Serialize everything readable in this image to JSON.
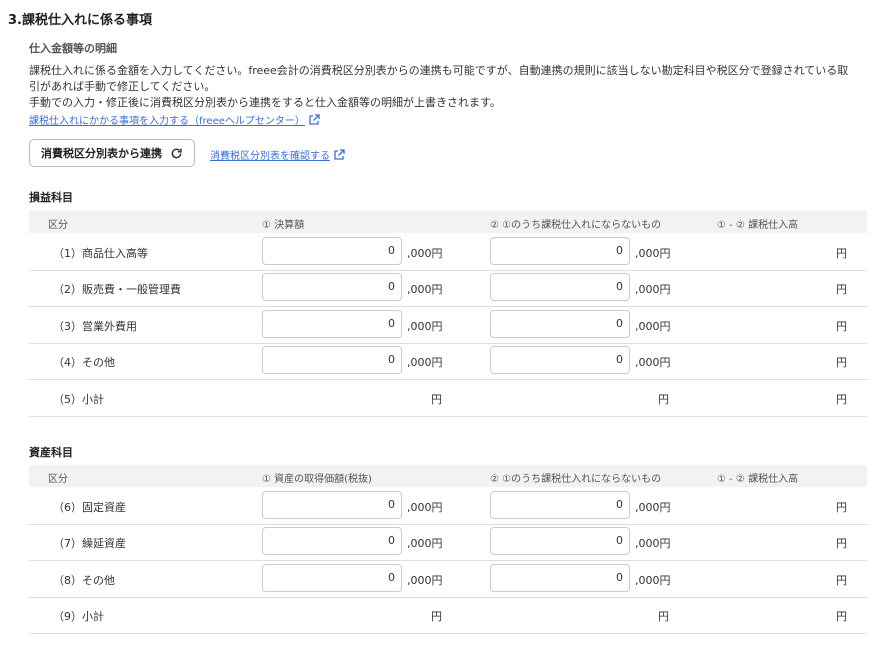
{
  "section_title": "3.課税仕入れに係る事項",
  "subsection_title": "仕入金額等の明細",
  "description_lines": [
    "課税仕入れに係る金額を入力してください。freee会計の消費税区分別表からの連携も可能ですが、自動連携の規則に該当しない勘定科目や税区分で登録されている取",
    "引があれば手動で修正してください。",
    "手動での入力・修正後に消費税区分別表から連携をすると仕入金額等の明細が上書きされます。"
  ],
  "help_link": "課税仕入れにかかる事項を入力する（freeeヘルプセンター）",
  "sync_button": "消費税区分別表から連携",
  "confirm_link": "消費税区分別表を確認する",
  "colors": {
    "link": "#3b6fd6",
    "header_bg": "#f2f2f2"
  },
  "icons": [
    "external-link-icon",
    "refresh-icon"
  ],
  "profit": {
    "title": "損益科目",
    "headers": [
      "区分",
      "① 決算額",
      "② ①のうち課税仕入れにならないもの",
      "① - ② 課税仕入高"
    ],
    "rows": [
      {
        "label": "（1）商品仕入高等",
        "v1": "0",
        "v2": "0"
      },
      {
        "label": "（2）販売費・一般管理費",
        "v1": "0",
        "v2": "0"
      },
      {
        "label": "（3）営業外費用",
        "v1": "0",
        "v2": "0"
      },
      {
        "label": "（4）その他",
        "v1": "0",
        "v2": "0"
      }
    ],
    "subtotal_label": "（5）小計"
  },
  "asset": {
    "title": "資産科目",
    "headers": [
      "区分",
      "① 資産の取得価額(税抜)",
      "② ①のうち課税仕入れにならないもの",
      "① - ② 課税仕入高"
    ],
    "rows": [
      {
        "label": "（6）固定資産",
        "v1": "0",
        "v2": "0"
      },
      {
        "label": "（7）繰延資産",
        "v1": "0",
        "v2": "0"
      },
      {
        "label": "（8）その他",
        "v1": "0",
        "v2": "0"
      }
    ],
    "subtotal_label": "（9）小計"
  },
  "unit_thousand": ",000円",
  "unit_yen": "円"
}
